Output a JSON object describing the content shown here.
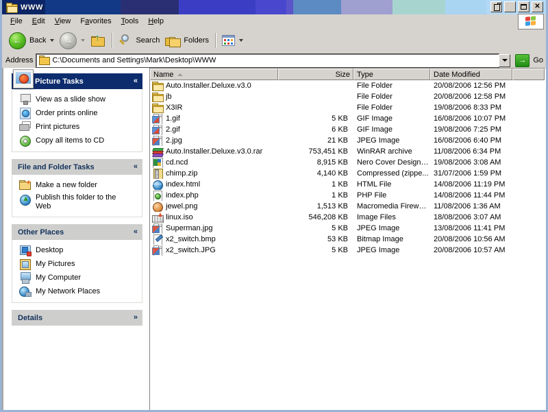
{
  "window": {
    "title": "WWW",
    "folder_icon": "folder-icon",
    "buttons": {
      "restore_label": "",
      "minimize_label": "",
      "maximize_label": "",
      "close_label": "✕"
    }
  },
  "menubar": {
    "items": [
      {
        "label": "File",
        "accel": "F"
      },
      {
        "label": "Edit",
        "accel": "E"
      },
      {
        "label": "View",
        "accel": "V"
      },
      {
        "label": "Favorites",
        "accel": "a"
      },
      {
        "label": "Tools",
        "accel": "T"
      },
      {
        "label": "Help",
        "accel": "H"
      }
    ],
    "logo": "windows-flag-logo"
  },
  "toolbar": {
    "back_label": "Back",
    "forward_label": "",
    "up_label": "",
    "search_label": "Search",
    "folders_label": "Folders",
    "views_label": ""
  },
  "address": {
    "label": "Address",
    "path": "C:\\Documents and Settings\\Mark\\Desktop\\WWW",
    "go_label": "Go",
    "go_glyph": "→"
  },
  "sidebar": {
    "panels": [
      {
        "title": "Picture Tasks",
        "style": "blue",
        "chevron": "«",
        "items": [
          {
            "label": "View as a slide show",
            "icon": "slideshow-icon"
          },
          {
            "label": "Order prints online",
            "icon": "order-prints-icon"
          },
          {
            "label": "Print pictures",
            "icon": "printer-icon"
          },
          {
            "label": "Copy all items to CD",
            "icon": "cd-burn-icon"
          }
        ]
      },
      {
        "title": "File and Folder Tasks",
        "style": "grey",
        "chevron": "«",
        "items": [
          {
            "label": "Make a new folder",
            "icon": "new-folder-icon"
          },
          {
            "label": "Publish this folder to the Web",
            "icon": "publish-web-icon"
          }
        ]
      },
      {
        "title": "Other Places",
        "style": "grey",
        "chevron": "«",
        "items": [
          {
            "label": "Desktop",
            "icon": "desktop-icon"
          },
          {
            "label": "My Pictures",
            "icon": "my-pictures-icon"
          },
          {
            "label": "My Computer",
            "icon": "my-computer-icon"
          },
          {
            "label": "My Network Places",
            "icon": "my-network-places-icon"
          }
        ]
      },
      {
        "title": "Details",
        "style": "grey",
        "chevron": "»",
        "items": []
      }
    ]
  },
  "filelist": {
    "columns": [
      {
        "label": "Name",
        "sorted": "asc"
      },
      {
        "label": "Size"
      },
      {
        "label": "Type"
      },
      {
        "label": "Date Modified"
      },
      {
        "label": ""
      }
    ],
    "rows": [
      {
        "name": "Auto.Installer.Deluxe.v3.0",
        "size": "",
        "type": "File Folder",
        "date": "20/08/2006 12:56 PM",
        "icon": "folder-icon"
      },
      {
        "name": "jb",
        "size": "",
        "type": "File Folder",
        "date": "20/08/2006 12:58 PM",
        "icon": "folder-icon"
      },
      {
        "name": "X3IR",
        "size": "",
        "type": "File Folder",
        "date": "19/08/2006 8:33 PM",
        "icon": "folder-icon"
      },
      {
        "name": "1.gif",
        "size": "5 KB",
        "type": "GIF Image",
        "date": "16/08/2006 10:07 PM",
        "icon": "gif-image-icon"
      },
      {
        "name": "2.gif",
        "size": "6 KB",
        "type": "GIF Image",
        "date": "19/08/2006 7:25 PM",
        "icon": "gif-image-icon"
      },
      {
        "name": "2.jpg",
        "size": "21 KB",
        "type": "JPEG Image",
        "date": "16/08/2006 6:40 PM",
        "icon": "jpeg-image-icon"
      },
      {
        "name": "Auto.Installer.Deluxe.v3.0.rar",
        "size": "753,451 KB",
        "type": "WinRAR archive",
        "date": "11/08/2006 6:34 PM",
        "icon": "winrar-icon"
      },
      {
        "name": "cd.ncd",
        "size": "8,915 KB",
        "type": "Nero Cover Designe...",
        "date": "19/08/2006 3:08 AM",
        "icon": "nero-cover-icon"
      },
      {
        "name": "chimp.zip",
        "size": "4,140 KB",
        "type": "Compressed (zippe...",
        "date": "31/07/2006 1:59 PM",
        "icon": "zip-icon"
      },
      {
        "name": "index.html",
        "size": "1 KB",
        "type": "HTML File",
        "date": "14/08/2006 11:19 PM",
        "icon": "html-file-icon"
      },
      {
        "name": "index.php",
        "size": "1 KB",
        "type": "PHP File",
        "date": "14/08/2006 11:44 PM",
        "icon": "php-file-icon"
      },
      {
        "name": "jewel.png",
        "size": "1,513 KB",
        "type": "Macromedia Firewor...",
        "date": "11/08/2006 1:36 AM",
        "icon": "fireworks-png-icon"
      },
      {
        "name": "linux.iso",
        "size": "546,208 KB",
        "type": "Image Files",
        "date": "18/08/2006 3:07 AM",
        "icon": "iso-image-icon"
      },
      {
        "name": "Superman.jpg",
        "size": "5 KB",
        "type": "JPEG Image",
        "date": "13/08/2006 11:41 PM",
        "icon": "jpeg-image-icon"
      },
      {
        "name": "x2_switch.bmp",
        "size": "53 KB",
        "type": "Bitmap Image",
        "date": "20/08/2006 10:56 AM",
        "icon": "bitmap-image-icon"
      },
      {
        "name": "x2_switch.JPG",
        "size": "5 KB",
        "type": "JPEG Image",
        "date": "20/08/2006 10:57 AM",
        "icon": "jpeg-image-icon"
      }
    ]
  },
  "colors": {
    "titlebar_start": "#0b2566",
    "panel_blue": "#0c2c6d",
    "panel_grey": "#cecfcd",
    "panel_text_blue": "#14315c",
    "window_face": "#d6d3ce",
    "accent_green": "#1f8b14"
  }
}
